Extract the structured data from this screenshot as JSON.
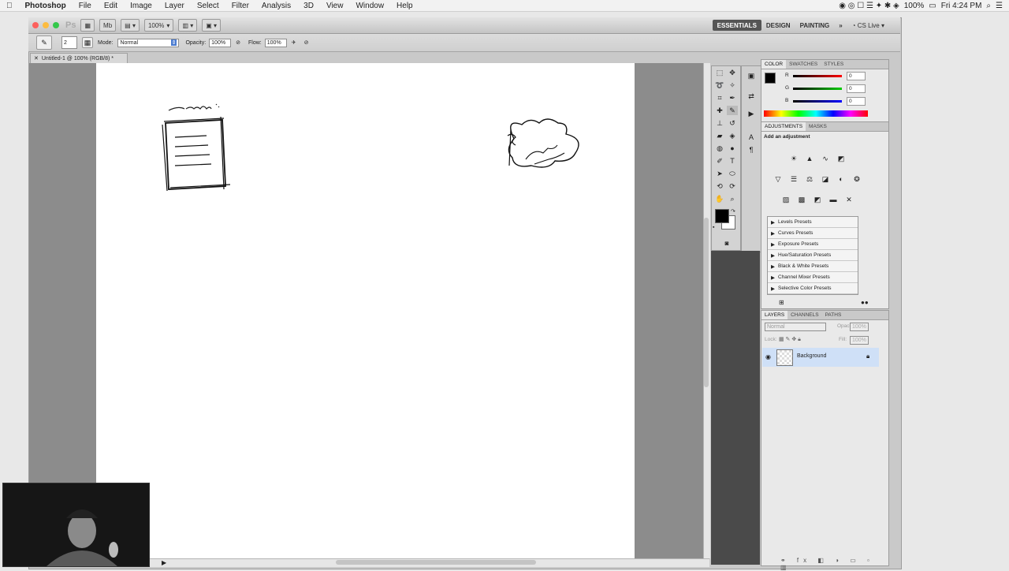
{
  "menubar": {
    "app": "Photoshop",
    "items": [
      "File",
      "Edit",
      "Image",
      "Layer",
      "Select",
      "Filter",
      "Analysis",
      "3D",
      "View",
      "Window",
      "Help"
    ],
    "battery": "100%",
    "clock": "Fri 4:24 PM"
  },
  "appbar": {
    "zoom": "100%",
    "workspaces": [
      "ESSENTIALS",
      "DESIGN",
      "PAINTING"
    ],
    "cs_live": "CS Live"
  },
  "options": {
    "brush_size": "2",
    "mode_label": "Mode:",
    "mode_value": "Normal",
    "opacity_label": "Opacity:",
    "opacity_value": "100%",
    "flow_label": "Flow:",
    "flow_value": "100%"
  },
  "document": {
    "tab": "Untitled-1 @ 100% (RGB/8) *",
    "sketch_left_label": "Campaign",
    "sketch_right_label": "Server API"
  },
  "color_panel": {
    "tabs": [
      "COLOR",
      "SWATCHES",
      "STYLES"
    ],
    "r_label": "R",
    "r_value": "0",
    "g_label": "G",
    "g_value": "0",
    "b_label": "B",
    "b_value": "0",
    "fg": "#000000"
  },
  "adjustments_panel": {
    "tabs": [
      "ADJUSTMENTS",
      "MASKS"
    ],
    "hint": "Add an adjustment",
    "presets": [
      "Levels Presets",
      "Curves Presets",
      "Exposure Presets",
      "Hue/Saturation Presets",
      "Black & White Presets",
      "Channel Mixer Presets",
      "Selective Color Presets"
    ]
  },
  "layers_panel": {
    "tabs": [
      "LAYERS",
      "CHANNELS",
      "PATHS"
    ],
    "blend": "Normal",
    "opacity_label": "Opacity:",
    "opacity_value": "100%",
    "lock_label": "Lock:",
    "fill_label": "Fill:",
    "fill_value": "100%",
    "layer_name": "Background"
  }
}
